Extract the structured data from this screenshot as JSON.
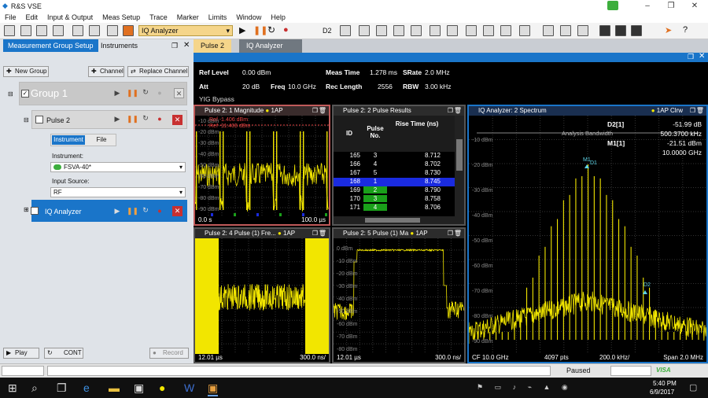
{
  "window": {
    "title": "R&S VSE"
  },
  "menu": [
    "File",
    "Edit",
    "Input & Output",
    "Meas Setup",
    "Trace",
    "Marker",
    "Limits",
    "Window",
    "Help"
  ],
  "toolbar": {
    "app_select": "IQ Analyzer",
    "trace_select": "D2"
  },
  "left": {
    "tabs": [
      "Measurement Group Setup",
      "Instruments"
    ],
    "new_group": "New Group",
    "channel": "Channel",
    "replace_channel": "Replace Channel",
    "group_name": "Group 1",
    "pulse_channel": "Pulse 2",
    "subtabs": [
      "Instrument",
      "File"
    ],
    "instrument_label": "Instrument:",
    "instrument_value": "FSVA-40*",
    "input_source_label": "Input Source:",
    "input_source_value": "RF",
    "iq_channel": "IQ Analyzer",
    "play": "Play",
    "cont": "CONT",
    "record": "Record"
  },
  "right_tabs": [
    "Pulse 2",
    "IQ Analyzer"
  ],
  "info": {
    "ref_level_label": "Ref Level",
    "ref_level": "0.00 dBm",
    "meas_time_label": "Meas Time",
    "meas_time": "1.278 ms",
    "srate_label": "SRate",
    "srate": "2.0 MHz",
    "att_label": "Att",
    "att": "20 dB",
    "freq_label": "Freq",
    "freq": "10.0 GHz",
    "rec_length_label": "Rec Length",
    "rec_length": "2556",
    "rbw_label": "RBW",
    "rbw": "3.00 kHz",
    "yig": "YIG Bypass"
  },
  "w1": {
    "title": "Pulse 2: 1 Magnitude",
    "badge": "1AP",
    "ref1": "Ref -1.406 dBm",
    "ref2": "Ref -11.406 dBm",
    "y_ticks": [
      "-10 dBm",
      "-20 dBm",
      "-30 dBm",
      "-40 dBm",
      "-50 dBm",
      "-60 dBm",
      "-70 dBm",
      "-80 dBm",
      "-90 dBm"
    ],
    "foot_l": "0.0 s",
    "foot_r": "100.0 µs"
  },
  "w2": {
    "title": "Pulse 2: 2 Pulse Results",
    "headers": [
      "ID",
      "Pulse No.",
      "Rise Time (ns)"
    ],
    "rows": [
      {
        "id": "165",
        "no": "3",
        "rt": "8.712",
        "style": "normal"
      },
      {
        "id": "166",
        "no": "4",
        "rt": "8.702",
        "style": "normal"
      },
      {
        "id": "167",
        "no": "5",
        "rt": "8.730",
        "style": "normal"
      },
      {
        "id": "168",
        "no": "1",
        "rt": "8.745",
        "style": "selected"
      },
      {
        "id": "169",
        "no": "2",
        "rt": "8.790",
        "style": "green"
      },
      {
        "id": "170",
        "no": "3",
        "rt": "8.758",
        "style": "green"
      },
      {
        "id": "171",
        "no": "4",
        "rt": "8.706",
        "style": "green"
      }
    ]
  },
  "w3": {
    "title": "IQ Analyzer: 2 Spectrum",
    "badge": "1AP Clrw",
    "d2_label": "D2[1]",
    "d2_val": "-51.99 dB",
    "d2_freq": "500.3700 kHz",
    "m1_label": "M1[1]",
    "m1_val": "-21.51 dBm",
    "m1_freq": "10.0000 GHz",
    "abw": "Analysis Bandwidth",
    "y_ticks": [
      "-10 dBm",
      "-20 dBm",
      "-30 dBm",
      "-40 dBm",
      "-50 dBm",
      "-60 dBm",
      "-70 dBm",
      "-80 dBm",
      "-90 dBm"
    ],
    "m1": "M1",
    "d1": "D1",
    "d2": "D2",
    "foot_cf": "CF 10.0 GHz",
    "foot_pts": "4097 pts",
    "foot_div": "200.0 kHz/",
    "foot_span": "Span 2.0 MHz"
  },
  "w4": {
    "title": "Pulse 2: 4 Pulse (1) Fre...",
    "badge": "1AP",
    "foot_l": "12.01 µs",
    "foot_r": "300.0 ns/"
  },
  "w5": {
    "title": "Pulse 2: 5 Pulse (1) Ma",
    "badge": "1AP",
    "y_ticks": [
      "0 dBm",
      "-10 dBm",
      "-20 dBm",
      "-30 dBm",
      "-40 dBm",
      "-50 dBm",
      "-60 dBm",
      "-70 dBm",
      "-80 dBm"
    ],
    "foot_l": "12.01 µs",
    "foot_r": "300.0 ns/"
  },
  "status": {
    "state": "Paused",
    "visa": "VISA"
  },
  "clock": {
    "time": "5:40 PM",
    "date": "6/9/2017"
  },
  "colors": {
    "accent": "#1a75c9",
    "trace": "#f2e600",
    "marker": "#5cd3e6",
    "close": "#c83030"
  }
}
